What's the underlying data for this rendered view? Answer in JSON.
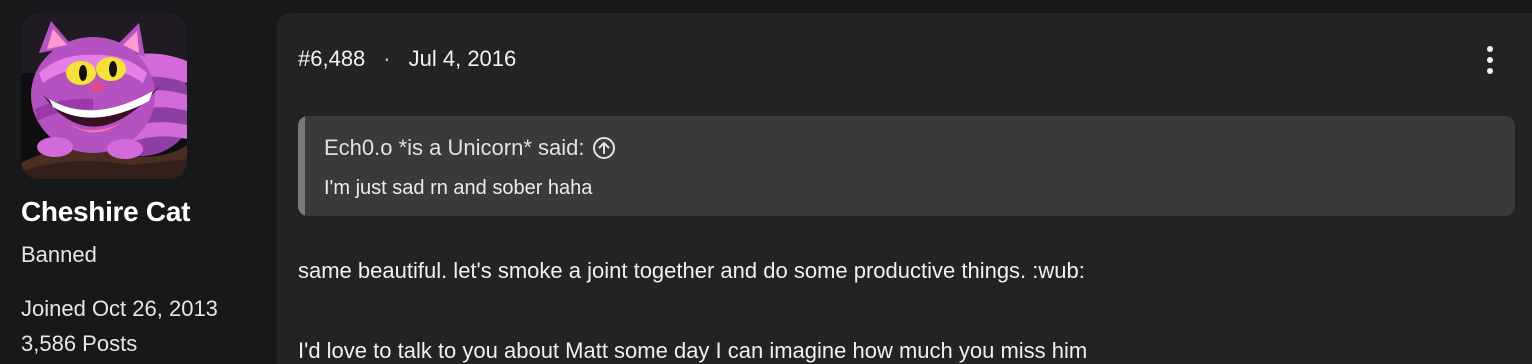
{
  "user": {
    "name": "Cheshire Cat",
    "title": "Banned",
    "joined": "Joined Oct 26, 2013",
    "posts": "3,586 Posts",
    "avatar_icon": "cheshire-cat-avatar"
  },
  "post": {
    "number": "#6,488",
    "separator": "·",
    "date": "Jul 4, 2016",
    "more_icon": "vertical-ellipsis-icon",
    "quote": {
      "attribution": "Ech0.o *is a Unicorn* said:",
      "jump_icon": "arrow-up-circle-icon",
      "text": "I'm just sad rn and sober haha"
    },
    "message_lines": [
      "same beautiful. let's smoke a joint together and do some productive things. :wub:",
      "I'd love to talk to you about Matt some day I can imagine how much you miss him"
    ]
  },
  "colors": {
    "page_bg": "#17181a",
    "card_bg": "#232323",
    "quote_bg": "#3a3a3b",
    "quote_bar": "#7a7a7c",
    "text": "#ececec"
  }
}
